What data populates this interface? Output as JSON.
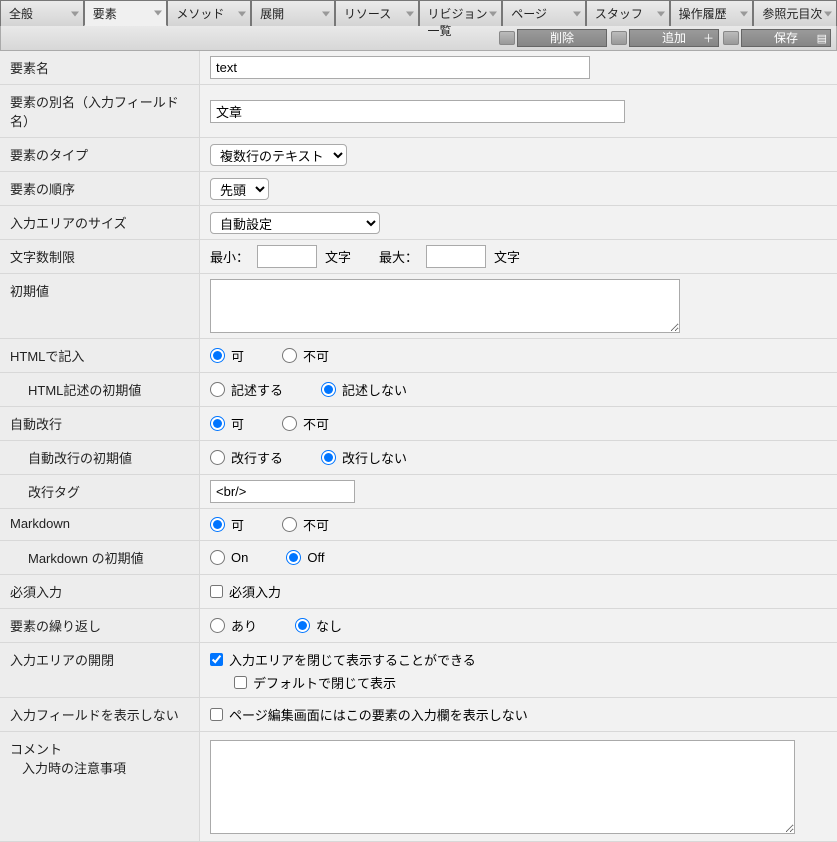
{
  "tabs": [
    "全般",
    "要素",
    "メソッド",
    "展開",
    "リソース",
    "リビジョン一覧",
    "ページ",
    "スタッフ",
    "操作履歴",
    "参照元目次"
  ],
  "active_tab_index": 1,
  "actions": {
    "delete": "削除",
    "add": "追加",
    "save": "保存"
  },
  "labels": {
    "name": "要素名",
    "alias": "要素の別名（入力フィールド名）",
    "type": "要素のタイプ",
    "order": "要素の順序",
    "input_size": "入力エリアのサイズ",
    "char_limit": "文字数制限",
    "min": "最小：",
    "max": "最大：",
    "chars": "文字",
    "default": "初期値",
    "html_input": "HTMLで記入",
    "html_default": "HTML記述の初期値",
    "auto_br": "自動改行",
    "auto_br_default": "自動改行の初期値",
    "br_tag": "改行タグ",
    "markdown": "Markdown",
    "markdown_default": "Markdown の初期値",
    "required": "必須入力",
    "repeat": "要素の繰り返し",
    "collapsible": "入力エリアの開閉",
    "hide_field": "入力フィールドを表示しない",
    "comment1": "コメント",
    "comment2": "入力時の注意事項"
  },
  "values": {
    "name": "text",
    "alias": "文章",
    "type": "複数行のテキスト",
    "order": "先頭",
    "input_size": "自動設定",
    "min": "",
    "max": "",
    "default_text": "",
    "br_tag": "<br/>",
    "comment_text": ""
  },
  "opts": {
    "yes": "可",
    "no": "不可",
    "write": "記述する",
    "nowrite": "記述しない",
    "break": "改行する",
    "nobreak": "改行しない",
    "on": "On",
    "off": "Off",
    "ari": "あり",
    "nashi": "なし",
    "required_cb": "必須入力",
    "collapsible_cb": "入力エリアを閉じて表示することができる",
    "collapsible_sub": "デフォルトで閉じて表示",
    "hide_field_cb": "ページ編集画面にはこの要素の入力欄を表示しない"
  }
}
